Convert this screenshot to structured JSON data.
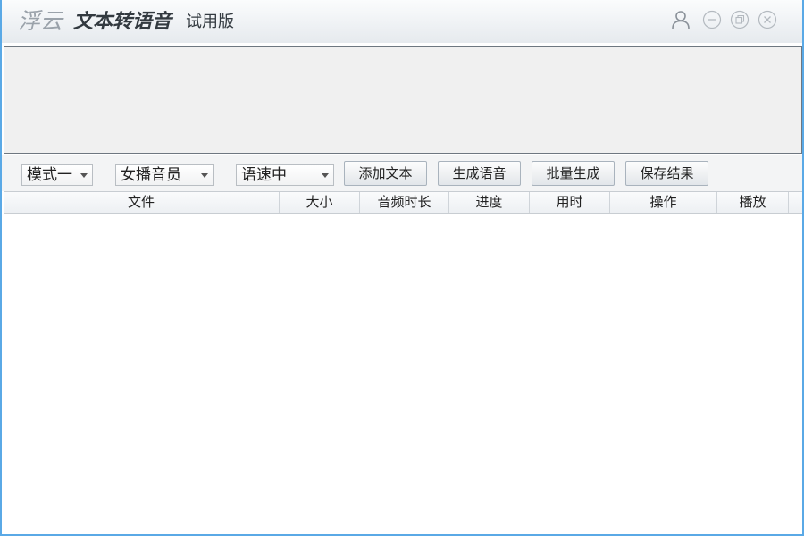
{
  "titlebar": {
    "brand": "浮云",
    "app_title": "文本转语音",
    "edition": "试用版",
    "icons": {
      "account": "user-icon",
      "minimize": "minimize-icon",
      "restore": "restore-icon",
      "close": "close-icon"
    }
  },
  "toolbar": {
    "mode": {
      "selected": "模式一"
    },
    "voice": {
      "selected": "女播音员"
    },
    "speed": {
      "selected": "语速中"
    },
    "add_text_label": "添加文本",
    "generate_label": "生成语音",
    "batch_label": "批量生成",
    "save_label": "保存结果"
  },
  "table": {
    "columns": [
      "文件",
      "大小",
      "音频时长",
      "进度",
      "用时",
      "操作",
      "播放"
    ],
    "rows": []
  },
  "colors": {
    "window_border": "#5aa9e6",
    "icon_gray": "#8a9199"
  }
}
